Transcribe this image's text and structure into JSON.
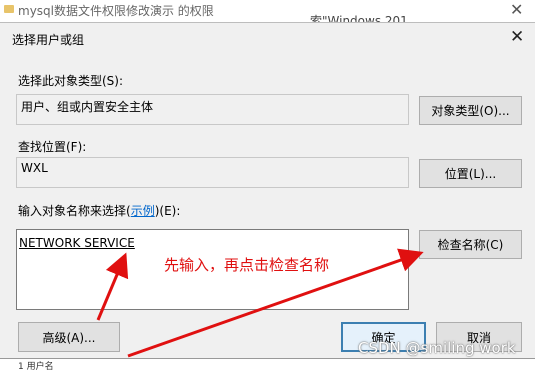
{
  "background_window": {
    "title": "mysql数据文件权限修改演示 的权限",
    "right_text": "索\"Windows 201...",
    "close_glyph": "✕"
  },
  "dialog": {
    "title": "选择用户或组",
    "close_glyph": "✕",
    "object_types": {
      "label": "选择此对象类型(S):",
      "value": "用户、组或内置安全主体",
      "button": "对象类型(O)..."
    },
    "location": {
      "label": "查找位置(F):",
      "value": "WXL",
      "button": "位置(L)..."
    },
    "names": {
      "label_prefix": "输入对象名称来选择(",
      "label_link": "示例",
      "label_suffix": ")(E):",
      "value": "NETWORK SERVICE",
      "check_button": "检查名称(C)"
    },
    "advanced_button": "高级(A)...",
    "ok_button": "确定",
    "cancel_button": "取消"
  },
  "annotation": {
    "text": "先输入，再点击检查名称",
    "color": "#e01010"
  },
  "watermark": "CSDN @smiling work",
  "bottom_text": "1 用户名"
}
